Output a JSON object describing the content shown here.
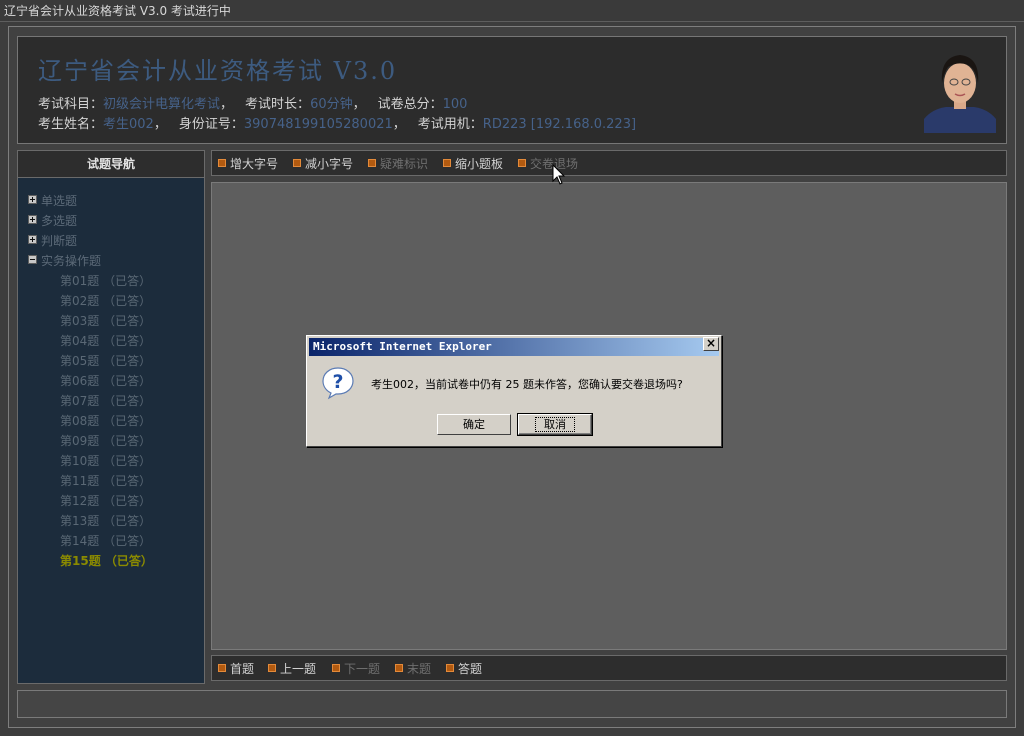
{
  "window": {
    "title": "辽宁省会计从业资格考试 V3.0 考试进行中"
  },
  "header": {
    "app_title": "辽宁省会计从业资格考试 V3.0",
    "subject_label": "考试科目：",
    "subject_value": "初级会计电算化考试",
    "duration_label": "考试时长：",
    "duration_value": "60分钟",
    "total_label": "试卷总分：",
    "total_value": "100",
    "name_label": "考生姓名：",
    "name_value": "考生002",
    "id_label": "身份证号：",
    "id_value": "390748199105280021",
    "machine_label": "考试用机：",
    "machine_value": "RD223 [192.168.0.223]"
  },
  "sidebar": {
    "title": "试题导航",
    "categories": [
      {
        "label": "单选题",
        "expanded": false
      },
      {
        "label": "多选题",
        "expanded": false
      },
      {
        "label": "判断题",
        "expanded": false
      },
      {
        "label": "实务操作题",
        "expanded": true
      }
    ],
    "questions": [
      "第01题 （已答）",
      "第02题 （已答）",
      "第03题 （已答）",
      "第04题 （已答）",
      "第05题 （已答）",
      "第06题 （已答）",
      "第07题 （已答）",
      "第08题 （已答）",
      "第09题 （已答）",
      "第10题 （已答）",
      "第11题 （已答）",
      "第12题 （已答）",
      "第13题 （已答）",
      "第14题 （已答）",
      "第15题 （已答）"
    ],
    "current_index": 14
  },
  "toolbar": {
    "enlarge": "增大字号",
    "shrink": "减小字号",
    "mark": "疑难标识",
    "minimize": "缩小题板",
    "submit": "交卷退场"
  },
  "navbar": {
    "first": "首题",
    "prev": "上一题",
    "next": "下一题",
    "last": "末题",
    "answer": "答题"
  },
  "dialog": {
    "title": "Microsoft Internet Explorer",
    "message": "考生002，当前试卷中仍有 25 题未作答，您确认要交卷退场吗?",
    "ok": "确定",
    "cancel": "取消",
    "close": "×"
  },
  "colors": {
    "accent": "#3d5b80",
    "sidebar_bg": "#1c2c3c",
    "current_item": "#8b8b00",
    "dialog_title_start": "#0a246a"
  }
}
